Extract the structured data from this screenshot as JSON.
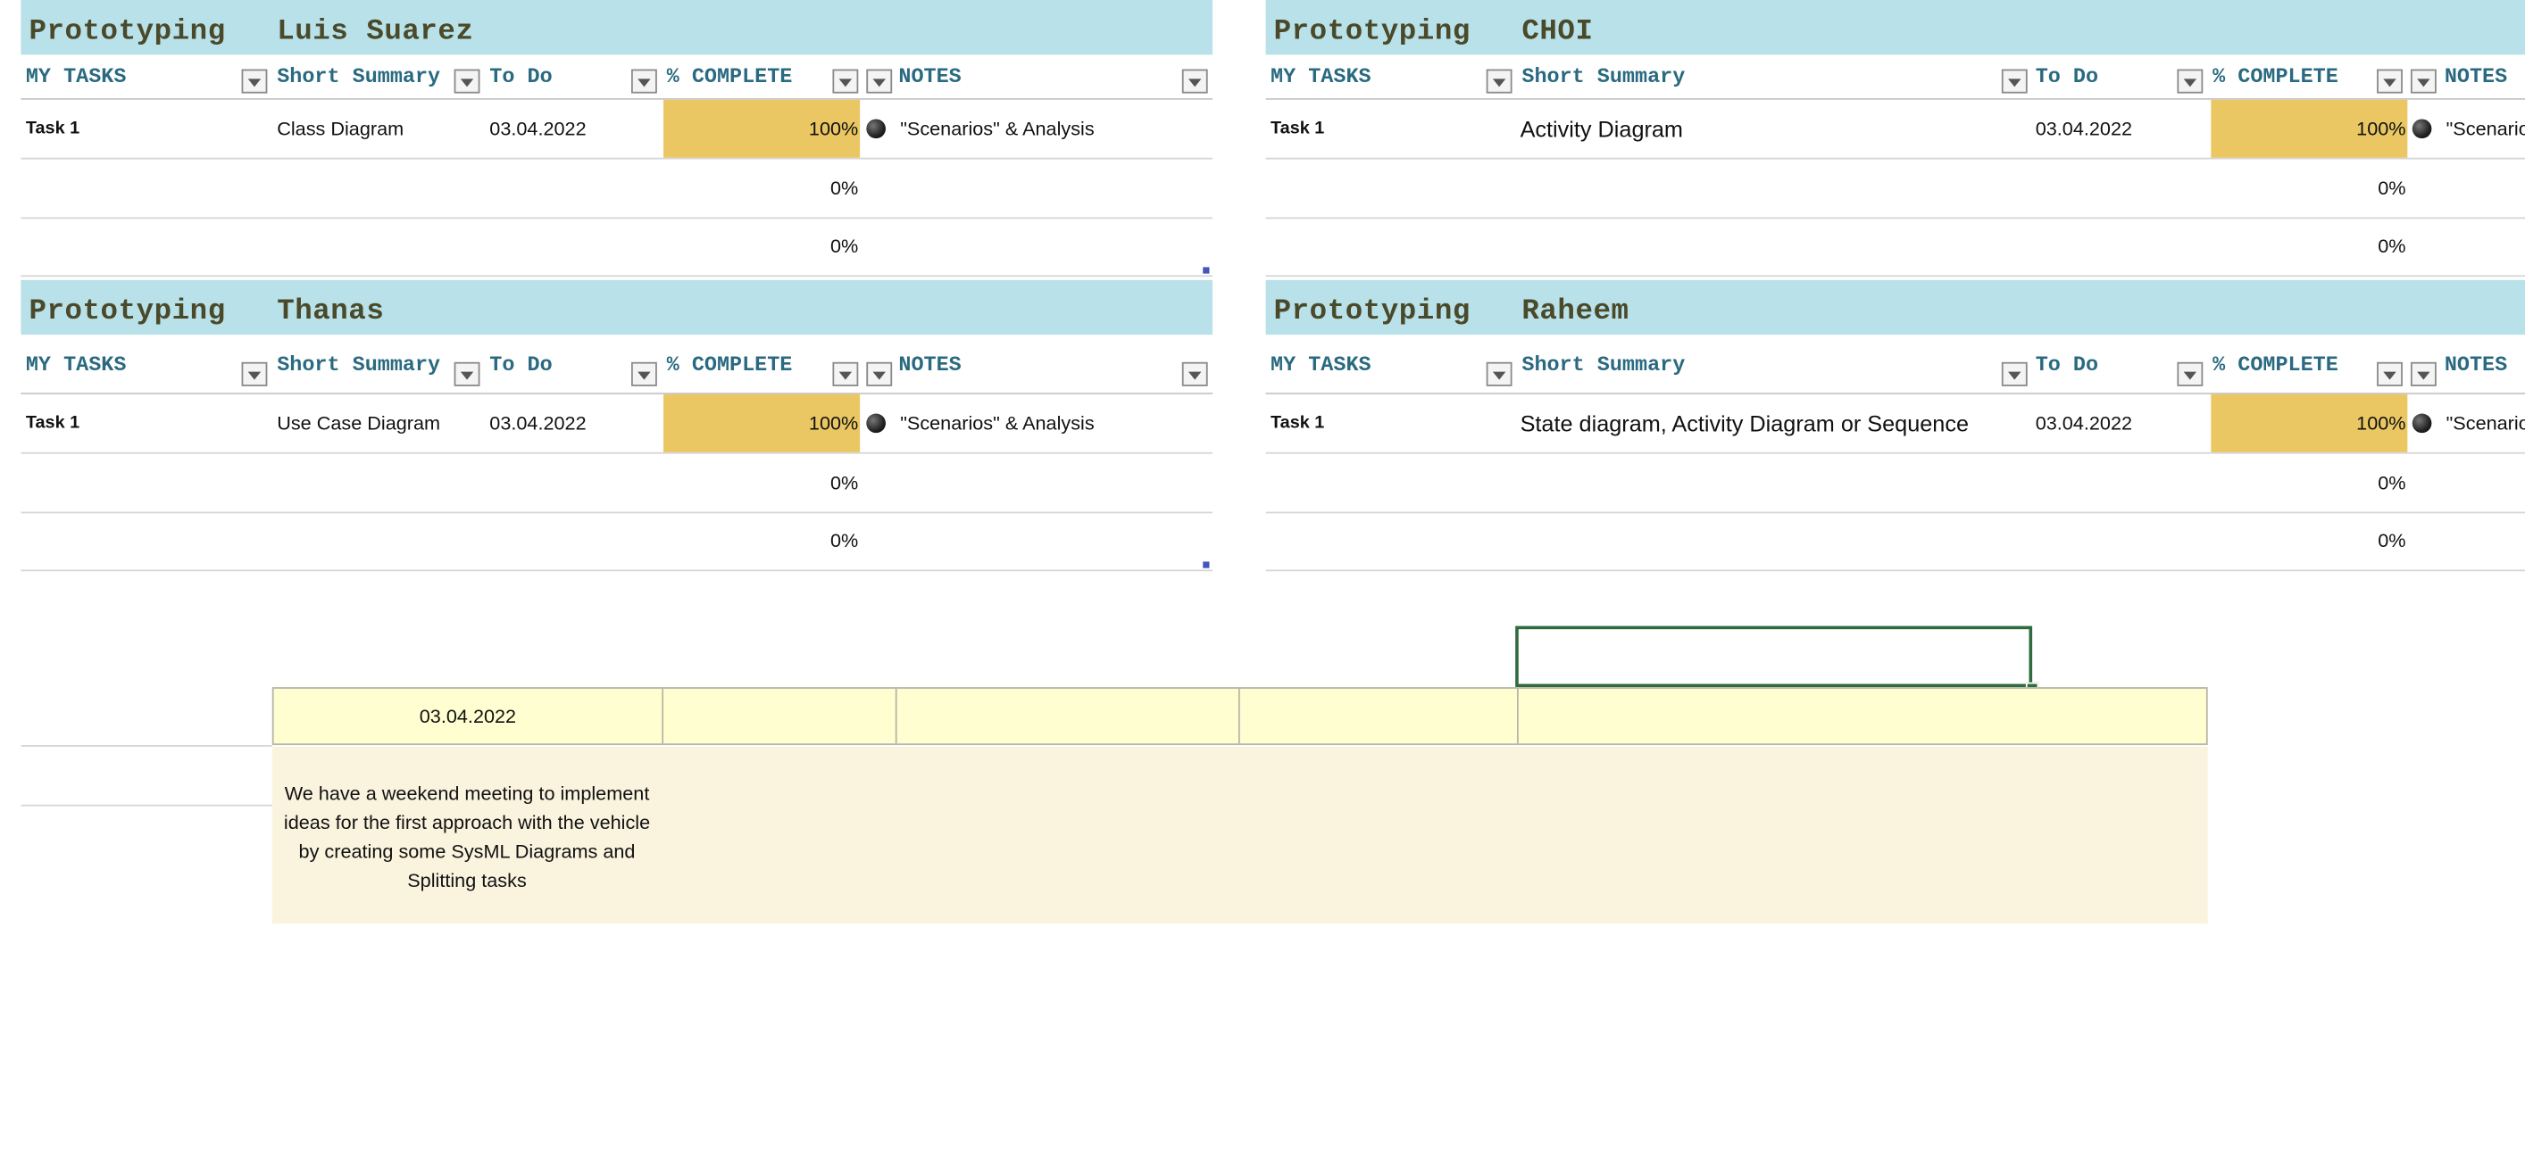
{
  "columns": {
    "my_tasks": "MY TASKS",
    "short_summary": "Short Summary",
    "to_do": "To Do",
    "complete": "% COMPLETE",
    "notes": "NOTES"
  },
  "boards": [
    {
      "phase": "Prototyping",
      "name": "Luis Suarez",
      "rows": [
        {
          "task": "Task 1",
          "summary": "Class Diagram",
          "date": "03.04.2022",
          "percent": "100%",
          "complete_fraction": 1.0,
          "note": "\"Scenarios\" & Analysis"
        },
        {
          "task": "",
          "summary": "",
          "date": "",
          "percent": "0%",
          "complete_fraction": 0,
          "note": ""
        },
        {
          "task": "",
          "summary": "",
          "date": "",
          "percent": "0%",
          "complete_fraction": 0,
          "note": ""
        }
      ]
    },
    {
      "phase": "Prototyping",
      "name": "CHOI",
      "rows": [
        {
          "task": "Task 1",
          "summary": "Activity Diagram",
          "date": "03.04.2022",
          "percent": "100%",
          "complete_fraction": 1.0,
          "note": "\"Scenarios"
        },
        {
          "task": "",
          "summary": "",
          "date": "",
          "percent": "0%",
          "complete_fraction": 0,
          "note": ""
        },
        {
          "task": "",
          "summary": "",
          "date": "",
          "percent": "0%",
          "complete_fraction": 0,
          "note": ""
        }
      ]
    },
    {
      "phase": "Prototyping",
      "name": "Thanas",
      "rows": [
        {
          "task": "Task 1",
          "summary": "Use Case Diagram",
          "date": "03.04.2022",
          "percent": "100%",
          "complete_fraction": 1.0,
          "note": "\"Scenarios\" & Analysis"
        },
        {
          "task": "",
          "summary": "",
          "date": "",
          "percent": "0%",
          "complete_fraction": 0,
          "note": ""
        },
        {
          "task": "",
          "summary": "",
          "date": "",
          "percent": "0%",
          "complete_fraction": 0,
          "note": ""
        }
      ]
    },
    {
      "phase": "Prototyping",
      "name": "Raheem",
      "rows": [
        {
          "task": "Task 1",
          "summary": "State diagram, Activity Diagram or Sequence",
          "date": "03.04.2022",
          "percent": "100%",
          "complete_fraction": 1.0,
          "note": "\"Scenario"
        },
        {
          "task": "",
          "summary": "",
          "date": "",
          "percent": "0%",
          "complete_fraction": 0,
          "note": ""
        },
        {
          "task": "",
          "summary": "",
          "date": "",
          "percent": "0%",
          "complete_fraction": 0,
          "note": ""
        }
      ]
    }
  ],
  "schedule": {
    "date": "03.04.2022",
    "note": "We have a weekend meeting to implement ideas for the first approach with the vehicle by creating some SysML Diagrams and Splitting tasks"
  },
  "colors": {
    "title_bar": "#b9e1ea",
    "complete_fill": "#eac762",
    "header_text": "#2a6a80",
    "schedule_fill": "#fefed0",
    "notes_fill": "#faf3de",
    "selection": "#2f6b3f"
  }
}
